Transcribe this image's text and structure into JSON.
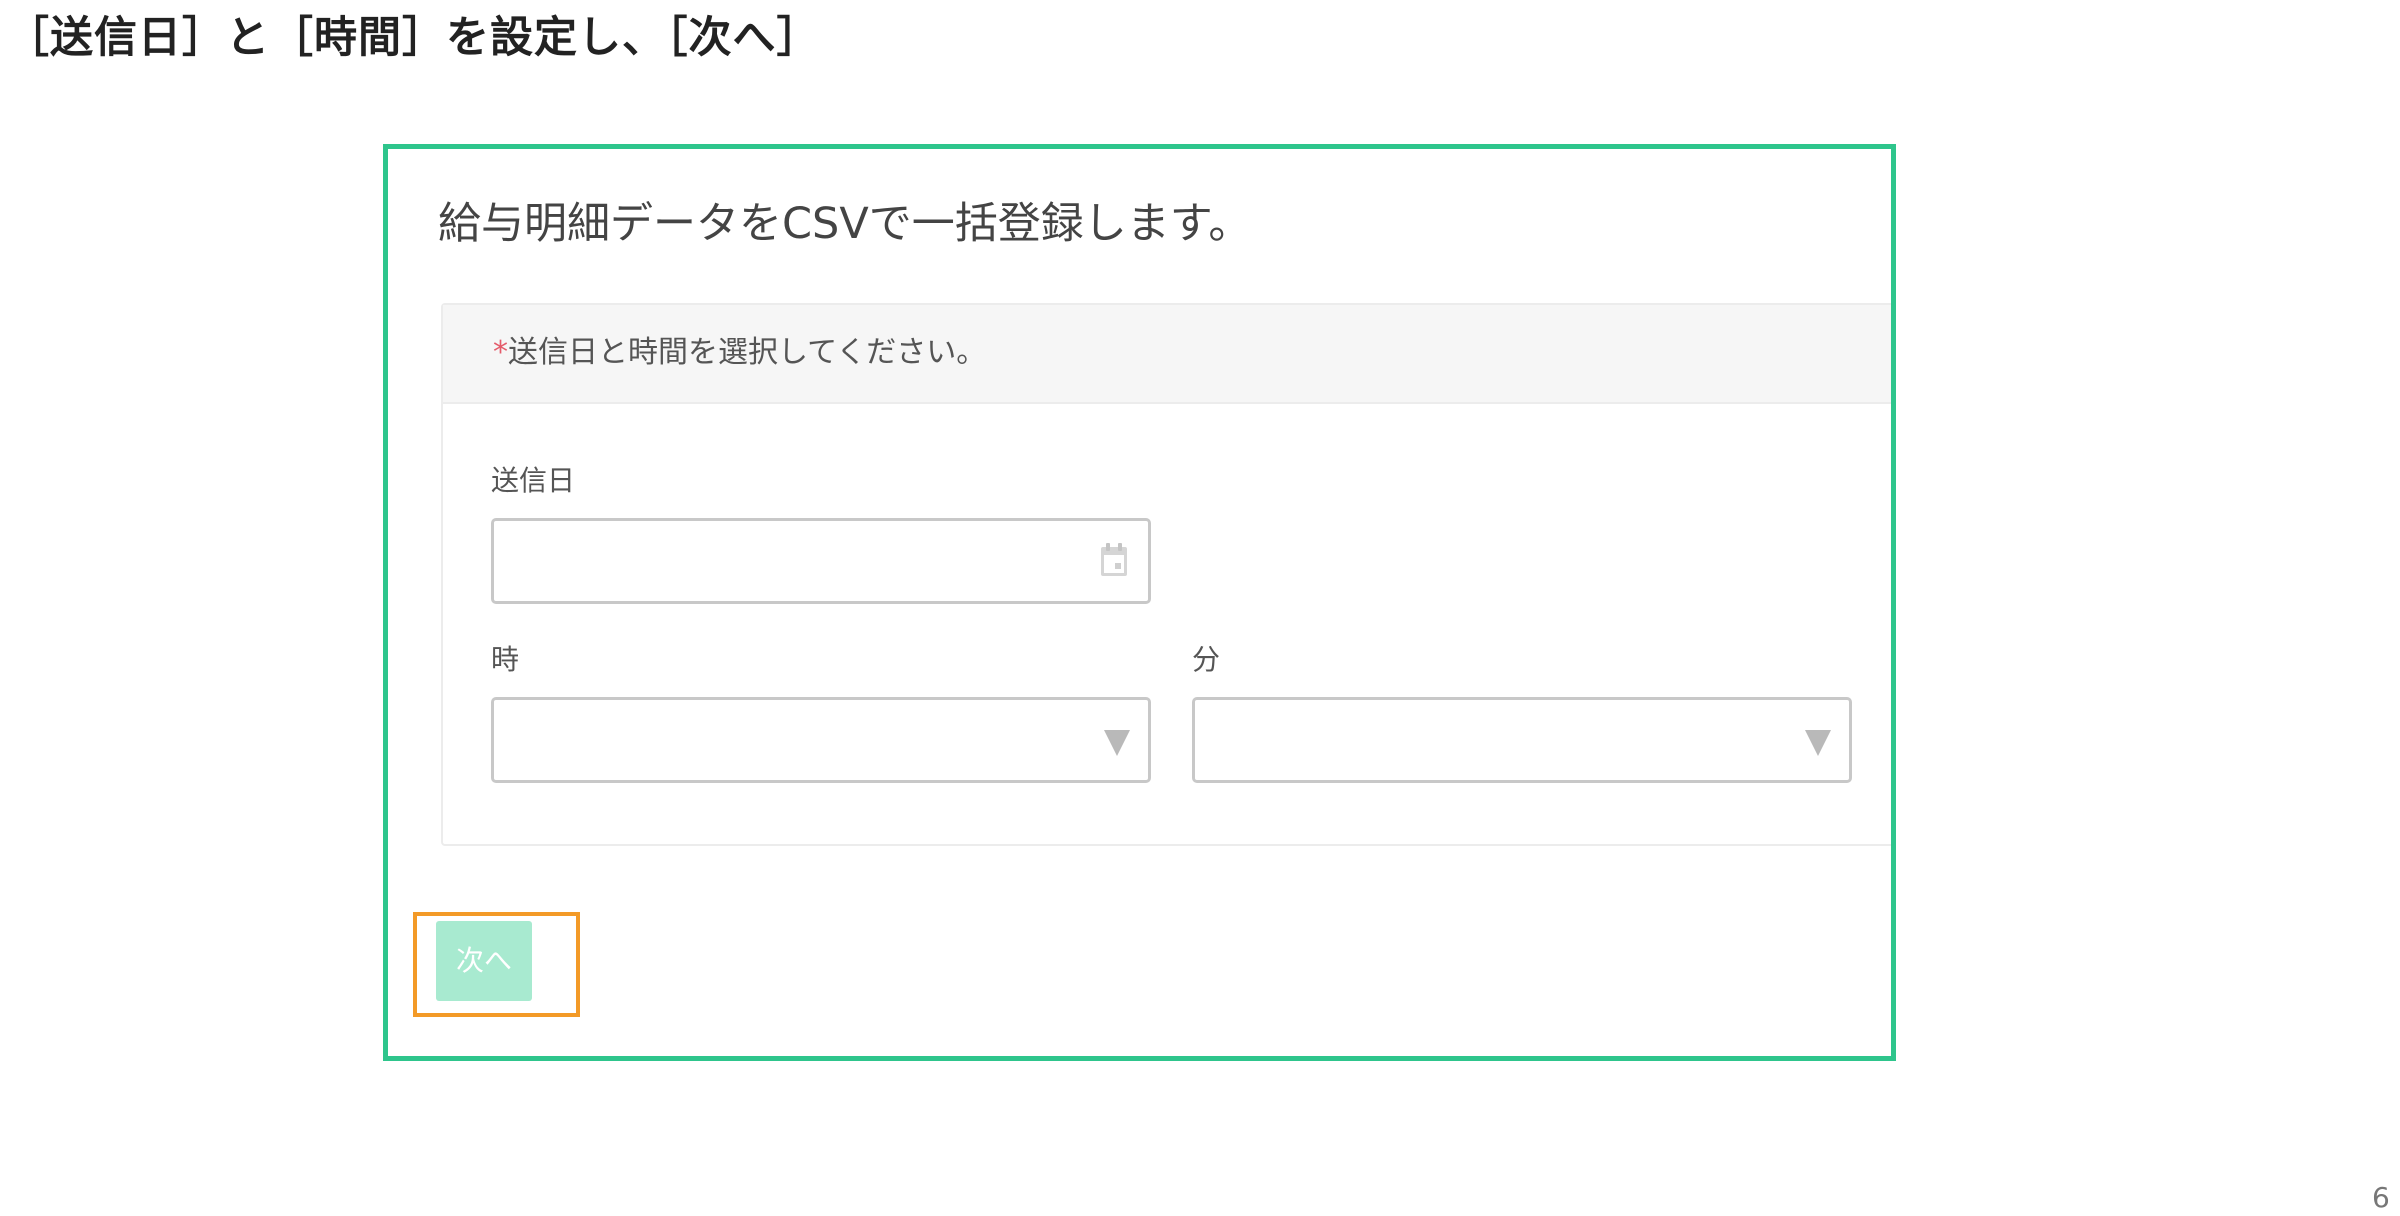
{
  "slide": {
    "title": "［送信日］と［時間］を設定し、［次へ］",
    "page_number": "6"
  },
  "form": {
    "title": "給与明細データをCSVで一括登録します。",
    "panel": {
      "required_mark": "*",
      "instruction": "送信日と時間を選択してください。"
    },
    "send_date": {
      "label": "送信日",
      "value": "",
      "icon": "calendar-icon"
    },
    "hour": {
      "label": "時",
      "selected": "",
      "icon": "dropdown-arrow-icon"
    },
    "minute": {
      "label": "分",
      "selected": "",
      "icon": "dropdown-arrow-icon"
    },
    "next_button": {
      "label": "次へ"
    }
  },
  "colors": {
    "frame_border": "#2ec58c",
    "highlight_border": "#f39a27",
    "button_background": "#a8ead0",
    "required_mark": "#e45b6a"
  }
}
